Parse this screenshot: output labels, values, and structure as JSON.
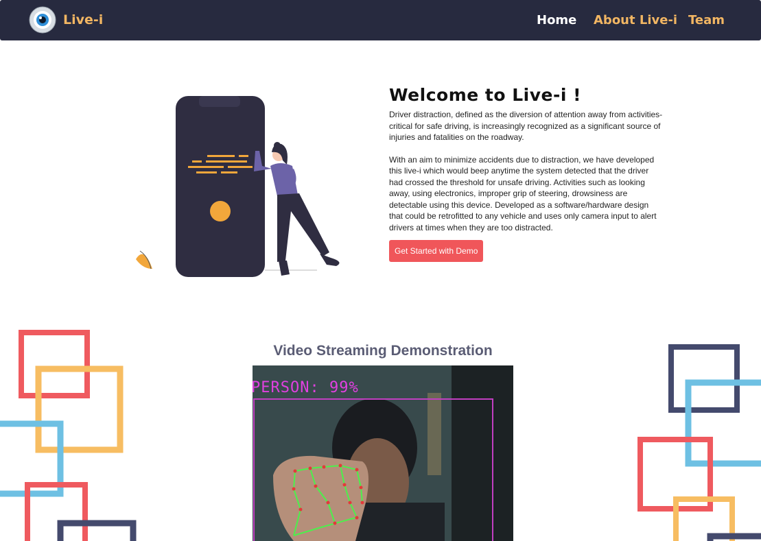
{
  "nav": {
    "brand": "Live-i",
    "links": [
      "Home",
      "About Live-i",
      "Team"
    ]
  },
  "hero": {
    "title": "Welcome to Live-i !",
    "paragraph1": "Driver distraction, defined as the diversion of attention away from activities-critical for safe driving, is increasingly recognized as a significant source of injuries and fatalities on the roadway.",
    "paragraph2": "With an aim to minimize accidents due to distraction, we have developed this live-i which would beep anytime the system detected that the driver had crossed the threshold for unsafe driving. Activities such as looking away, using electronics, improper grip of steering, drowsiness are detectable using this device. Developed as a software/hardware design that could be retrofitted to any vehicle and uses only camera input to alert drivers at times when they are too distracted.",
    "cta": "Get Started with Demo"
  },
  "video": {
    "title": "Video Streaming Demonstration",
    "detection_label": "PERSON: 99%"
  },
  "colors": {
    "navbar": "#272a3f",
    "accent": "#f2b663",
    "cta": "#f0565a",
    "deco_red": "#ef5a5f",
    "deco_orange": "#f7bd62",
    "deco_blue": "#6ec0e3",
    "deco_navy": "#444a6d"
  }
}
